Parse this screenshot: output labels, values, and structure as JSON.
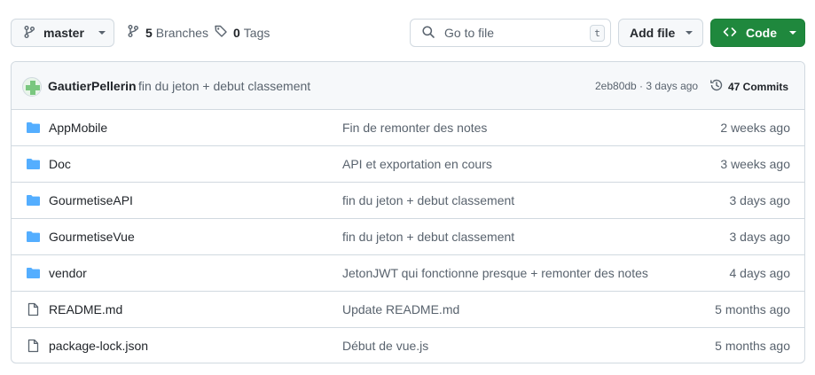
{
  "toolbar": {
    "branch": {
      "icon": "git-branch-icon",
      "label": "master"
    },
    "branches": {
      "count": "5",
      "label": "Branches"
    },
    "tags": {
      "count": "0",
      "label": "Tags"
    },
    "search": {
      "placeholder": "Go to file",
      "shortcut": "t"
    },
    "add_file_label": "Add file",
    "code_label": "Code",
    "code_color": "#1f883d"
  },
  "commit": {
    "author": "GautierPellerin",
    "message": "fin du jeton + debut classement",
    "sha_and_time": "2eb80db · 3 days ago",
    "commits_count_label": "47 Commits"
  },
  "files": [
    {
      "type": "folder",
      "name": "AppMobile",
      "message": "Fin de remonter des notes",
      "date": "2 weeks ago"
    },
    {
      "type": "folder",
      "name": "Doc",
      "message": "API et exportation en cours",
      "date": "3 weeks ago"
    },
    {
      "type": "folder",
      "name": "GourmetiseAPI",
      "message": "fin du jeton + debut classement",
      "date": "3 days ago"
    },
    {
      "type": "folder",
      "name": "GourmetiseVue",
      "message": "fin du jeton + debut classement",
      "date": "3 days ago"
    },
    {
      "type": "folder",
      "name": "vendor",
      "message": "JetonJWT qui fonctionne presque + remonter des notes",
      "date": "4 days ago"
    },
    {
      "type": "file",
      "name": "README.md",
      "message": "Update README.md",
      "date": "5 months ago"
    },
    {
      "type": "file",
      "name": "package-lock.json",
      "message": "Début de vue.js",
      "date": "5 months ago"
    }
  ],
  "colors": {
    "folder": "#54aeff",
    "file": "#59636e",
    "border": "#d1d9e0"
  }
}
